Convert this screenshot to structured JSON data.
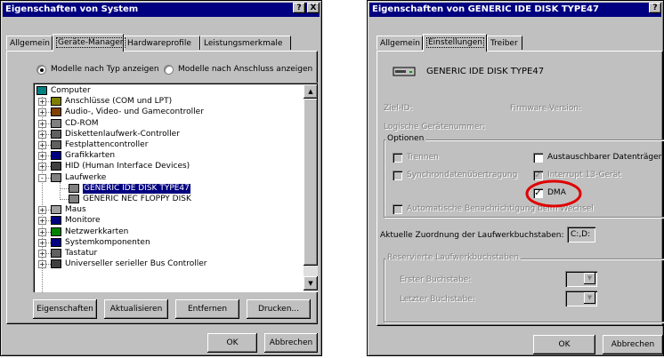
{
  "left_dialog": {
    "title": "Eigenschaften von System",
    "title_buttons": [
      "?",
      "X"
    ],
    "tabs": [
      "Allgemein",
      "Geräte-Manager",
      "Hardwareprofile",
      "Leistungsmerkmale"
    ],
    "active_tab": "Geräte-Manager",
    "radio_type": "Modelle nach Typ anzeigen",
    "radio_connection": "Modelle nach Anschluss anzeigen",
    "tree": [
      {
        "label": "Computer",
        "icon": "computer-icon",
        "level": 0,
        "expander": ""
      },
      {
        "label": "Anschlüsse (COM und LPT)",
        "icon": "port-icon",
        "level": 1,
        "expander": "+"
      },
      {
        "label": "Audio-, Video- und Gamecontroller",
        "icon": "audio-icon",
        "level": 1,
        "expander": "+"
      },
      {
        "label": "CD-ROM",
        "icon": "cdrom-icon",
        "level": 1,
        "expander": "+"
      },
      {
        "label": "Diskettenlaufwerk-Controller",
        "icon": "controller-icon",
        "level": 1,
        "expander": "+"
      },
      {
        "label": "Festplattencontroller",
        "icon": "controller-icon",
        "level": 1,
        "expander": "+"
      },
      {
        "label": "Grafikkarten",
        "icon": "display-icon",
        "level": 1,
        "expander": "+"
      },
      {
        "label": "HID (Human Interface Devices)",
        "icon": "hid-icon",
        "level": 1,
        "expander": "+"
      },
      {
        "label": "Laufwerke",
        "icon": "drive-icon",
        "level": 1,
        "expander": "-"
      },
      {
        "label": "GENERIC IDE  DISK TYPE47",
        "icon": "drive-icon",
        "level": 2,
        "expander": "",
        "selected": true
      },
      {
        "label": "GENERIC NEC  FLOPPY DISK",
        "icon": "drive-icon",
        "level": 2,
        "expander": ""
      },
      {
        "label": "Maus",
        "icon": "mouse-icon",
        "level": 1,
        "expander": "+"
      },
      {
        "label": "Monitore",
        "icon": "monitor-icon",
        "level": 1,
        "expander": "+"
      },
      {
        "label": "Netzwerkkarten",
        "icon": "network-icon",
        "level": 1,
        "expander": "+"
      },
      {
        "label": "Systemkomponenten",
        "icon": "system-icon",
        "level": 1,
        "expander": "+"
      },
      {
        "label": "Tastatur",
        "icon": "keyboard-icon",
        "level": 1,
        "expander": "+"
      },
      {
        "label": "Universeller serieller Bus Controller",
        "icon": "usb-icon",
        "level": 1,
        "expander": "+"
      }
    ],
    "buttons": {
      "properties": "Eigenschaften",
      "refresh": "Aktualisieren",
      "remove": "Entfernen",
      "print": "Drucken..."
    },
    "ok": "OK",
    "cancel": "Abbrechen"
  },
  "right_dialog": {
    "title": "Eigenschaften von GENERIC IDE  DISK TYPE47",
    "title_buttons": [
      "?"
    ],
    "tabs": [
      "Allgemein",
      "Einstellungen",
      "Treiber"
    ],
    "active_tab": "Einstellungen",
    "device_name": "GENERIC IDE  DISK TYPE47",
    "target_id_label": "Ziel-ID:",
    "firmware_label": "Firmware-Version:",
    "lun_label": "Logische Gerätenummer:",
    "options_label": "Optionen",
    "opt_disconnect": "Trennen",
    "opt_removable": "Austauschbarer Datenträger",
    "opt_sync": "Synchrondatenübertragung",
    "opt_int13": "Interrupt 13-Gerät",
    "opt_dma": "DMA",
    "opt_autonotify": "Automatische Benachrichtigung beim Wechsel",
    "current_letters_label": "Aktuelle Zuordnung der Laufwerkbuchstaben:",
    "current_letters_value": "C:,D:",
    "reserved_label": "Reservierte Laufwerkbuchstaben",
    "first_letter_label": "Erster Buchstabe:",
    "last_letter_label": "Letzter Buchstabe:",
    "ok": "OK",
    "cancel": "Abbrechen",
    "highlight_color": "#e00000"
  }
}
